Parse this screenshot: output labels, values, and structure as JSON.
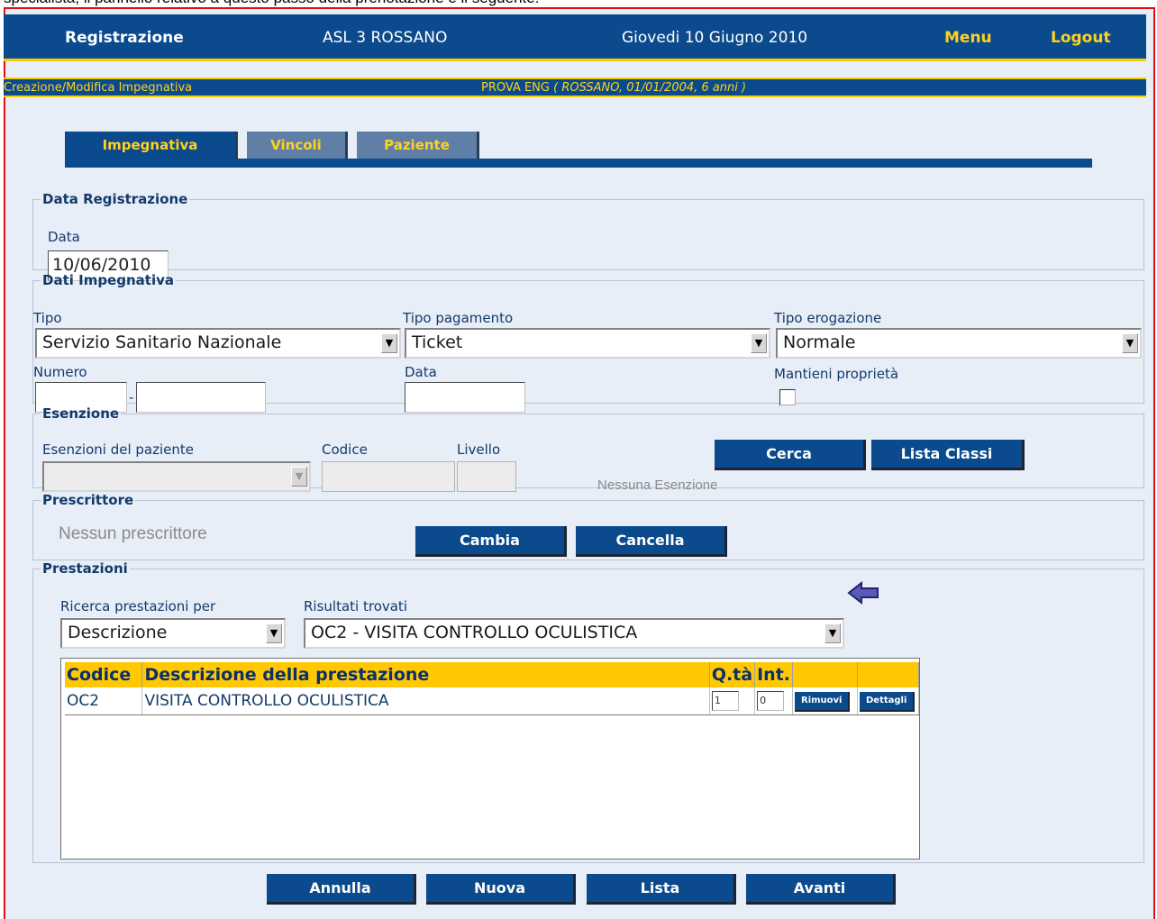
{
  "doc_text": "specialista, il pannello relativo a questo passo della prenotazione è il seguente:",
  "topbar": {
    "title": "Registrazione",
    "asl": "ASL 3 ROSSANO",
    "date": "Giovedi 10 Giugno 2010",
    "menu": "Menu",
    "logout": "Logout"
  },
  "subbar": {
    "section": "Creazione/Modifica Impegnativa",
    "patient": "PROVA ENG",
    "patient_info": "( ROSSANO, 01/01/2004, 6 anni )"
  },
  "tabs": [
    {
      "label": "Impegnativa",
      "active": true
    },
    {
      "label": "Vincoli",
      "active": false
    },
    {
      "label": "Paziente",
      "active": false
    }
  ],
  "data_registrazione": {
    "legend": "Data Registrazione",
    "label": "Data",
    "value": "10/06/2010"
  },
  "dati_impegnativa": {
    "legend": "Dati Impegnativa",
    "tipo_label": "Tipo",
    "tipo_value": "Servizio Sanitario Nazionale",
    "pagamento_label": "Tipo pagamento",
    "pagamento_value": "Ticket",
    "erogazione_label": "Tipo erogazione",
    "erogazione_value": "Normale",
    "numero_label": "Numero",
    "numero_part1": "",
    "numero_part2": "",
    "data_label": "Data",
    "data_value": "",
    "mantieni_label": "Mantieni proprietà",
    "mantieni_checked": false
  },
  "esenzione": {
    "legend": "Esenzione",
    "esenzioni_label": "Esenzioni del paziente",
    "esenzioni_value": "",
    "codice_label": "Codice",
    "codice_value": "",
    "livello_label": "Livello",
    "livello_value": "",
    "cerca_button": "Cerca",
    "lista_button": "Lista Classi",
    "status": "Nessuna Esenzione"
  },
  "prescrittore": {
    "legend": "Prescrittore",
    "status": "Nessun prescrittore",
    "cambia_button": "Cambia",
    "cancella_button": "Cancella"
  },
  "prestazioni": {
    "legend": "Prestazioni",
    "ricerca_label": "Ricerca prestazioni per",
    "ricerca_value": "Descrizione",
    "risultati_label": "Risultati trovati",
    "risultati_value": "OC2 - VISITA CONTROLLO OCULISTICA",
    "table": {
      "headers": [
        "Codice",
        "Descrizione della prestazione",
        "Q.tà",
        "Int.",
        "",
        ""
      ],
      "rows": [
        {
          "codice": "OC2",
          "descrizione": "VISITA CONTROLLO OCULISTICA",
          "qta": "1",
          "int": "0",
          "rimuovi": "Rimuovi",
          "dettagli": "Dettagli"
        }
      ]
    }
  },
  "footer_buttons": {
    "annulla": "Annulla",
    "nuova": "Nuova",
    "lista": "Lista",
    "avanti": "Avanti"
  },
  "colors": {
    "primary_blue": "#0b4a8c",
    "accent_yellow": "#ffd21f",
    "header_yellow": "#ffc800",
    "frame_red": "#e01010",
    "panel_bg": "#e8eef8"
  }
}
